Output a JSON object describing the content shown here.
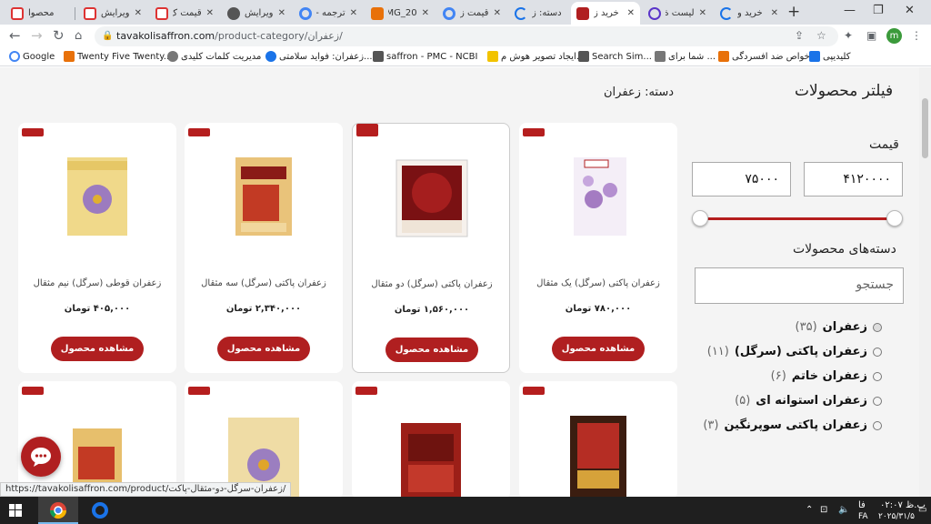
{
  "browser": {
    "tabs": [
      {
        "title": "محصوا",
        "fav": "#d33"
      },
      {
        "title": "ویرایش",
        "fav": "#d33"
      },
      {
        "title": "قیمت ک",
        "fav": "#d33"
      },
      {
        "title": "ویرایش",
        "fav": "#555"
      },
      {
        "title": "ترجمه -",
        "fav": "#4285f4"
      },
      {
        "title": "IMG_20",
        "fav": "#e8710a"
      },
      {
        "title": "قیمت ز",
        "fav": "#4285f4"
      },
      {
        "title": "دسته: ز",
        "fav": "#1a73e8"
      },
      {
        "title": "خرید ز",
        "fav": "#b01f20"
      },
      {
        "title": "لیست ة",
        "fav": "#5a35c9"
      },
      {
        "title": "خرید و",
        "fav": "#1a73e8"
      }
    ],
    "new_tab": "+",
    "url_host": "tavakolisaffron.com",
    "url_path": "/product-category/زعفران/",
    "avatar_letter": "m",
    "bookmarks": [
      {
        "label": "Google",
        "color": "#4285f4"
      },
      {
        "label": "Twenty Five Twenty...",
        "color": "#e8710a"
      },
      {
        "label": "مدیریت کلمات کلیدی",
        "color": "#777"
      },
      {
        "label": "زعفران: فواید سلامتی...",
        "color": "#1a73e8"
      },
      {
        "label": "saffron - PMC - NCBI",
        "color": "#555"
      },
      {
        "label": "ایجاد تصویر هوش م...",
        "color": "#f2c300"
      },
      {
        "label": "Search Sim...",
        "color": "#555"
      },
      {
        "label": "شما برای ...",
        "color": "#777"
      },
      {
        "label": "خواص ضد افسردگی...",
        "color": "#e8710a"
      },
      {
        "label": "کلیدیپی",
        "color": "#1a73e8"
      }
    ],
    "status_url": "https://tavakolisaffron.com/product/زعفران-سرگل-دو-مثقال-پاکت/"
  },
  "page": {
    "breadcrumb": "دسته: زعفران",
    "filter_title": "فیلتر محصولات",
    "price_label": "قیمت",
    "price_min": "۷۵۰۰۰",
    "price_max": "۴۱۲۰۰۰۰",
    "price_range_fraction": [
      0,
      1
    ],
    "categories_label": "دسته‌های محصولات",
    "search_placeholder": "جستجو",
    "categories": [
      {
        "name": "زعفران",
        "count": "(۳۵)",
        "selected": true
      },
      {
        "name": "زعفران پاکتی (سرگل)",
        "count": "(۱۱)"
      },
      {
        "name": "زعفران خاتم",
        "count": "(۶)"
      },
      {
        "name": "زعفران استوانه ای",
        "count": "(۵)"
      },
      {
        "name": "زعفران پاکتی سوپرنگین",
        "count": "(۳)"
      }
    ],
    "products": [
      {
        "name": "زعفران پاکتی (سرگل) یک مثقال",
        "price": "۷۸۰,۰۰۰ تومان",
        "button": "مشاهده محصول"
      },
      {
        "name": "زعفران پاکتی (سرگل) دو مثقال",
        "price": "۱,۵۶۰,۰۰۰ تومان",
        "button": "مشاهده محصول"
      },
      {
        "name": "زعفران پاکتی (سرگل) سه مثقال",
        "price": "۲,۳۴۰,۰۰۰ تومان",
        "button": "مشاهده محصول"
      },
      {
        "name": "زعفران قوطی (سرگل) نیم مثقال",
        "price": "۴۰۵,۰۰۰ تومان",
        "button": "مشاهده محصول"
      }
    ]
  },
  "taskbar": {
    "time": "۰۲:۰۷ ب.ظ",
    "date": "۲۰۲۵/۳۱/۵",
    "lang": "FA",
    "lang2": "فا"
  }
}
